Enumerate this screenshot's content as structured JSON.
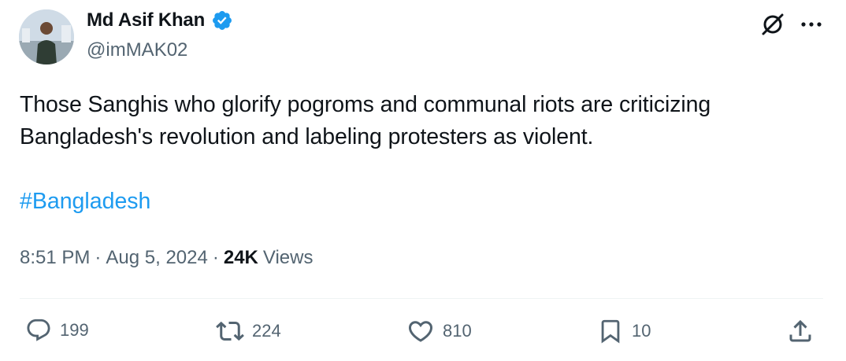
{
  "author": {
    "display_name": "Md Asif Khan",
    "handle": "@imMAK02",
    "verified": true
  },
  "tweet": {
    "text": "Those Sanghis who glorify pogroms and communal riots are criticizing Bangladesh's revolution and labeling protesters as violent.",
    "hashtag": "#Bangladesh"
  },
  "meta": {
    "time": "8:51 PM",
    "sep1": "·",
    "date": "Aug 5, 2024",
    "sep2": "·",
    "views_count": "24K",
    "views_label": "Views"
  },
  "actions": {
    "replies": "199",
    "reposts": "224",
    "likes": "810",
    "bookmarks": "10"
  },
  "icons": {
    "top_right": [
      "grok-icon",
      "more-icon"
    ],
    "action_bar": [
      "reply-icon",
      "repost-icon",
      "like-icon",
      "bookmark-icon",
      "share-icon"
    ]
  },
  "colors": {
    "accent": "#1d9bf0",
    "text": "#0f1419",
    "secondary": "#536471",
    "divider": "#eff3f4"
  }
}
